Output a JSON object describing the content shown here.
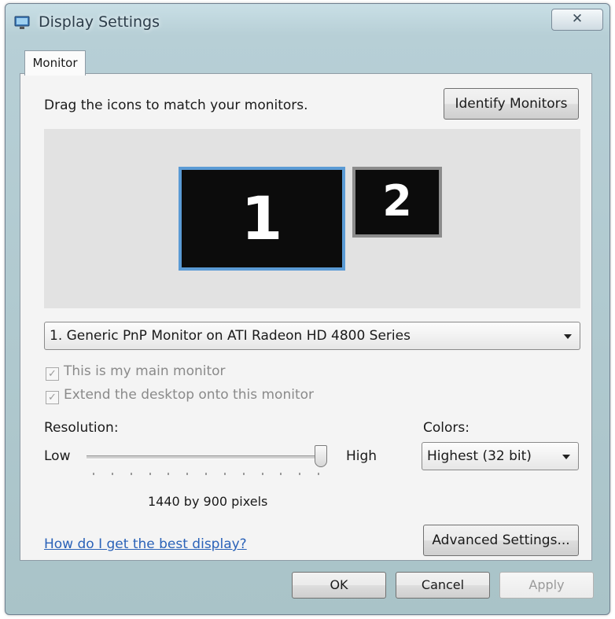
{
  "window": {
    "title": "Display Settings",
    "close_glyph": "✕",
    "icon": "display-settings-icon"
  },
  "tabs": [
    {
      "label": "Monitor",
      "selected": true
    }
  ],
  "monitor_tab": {
    "instruction": "Drag the icons to match your monitors.",
    "identify_button": "Identify Monitors",
    "monitors": [
      {
        "number": "1",
        "selected": true
      },
      {
        "number": "2",
        "selected": false
      }
    ],
    "monitor_select": {
      "value": "1. Generic PnP Monitor on ATI Radeon HD 4800 Series"
    },
    "main_monitor_checkbox": {
      "label": "This is my main monitor",
      "checked": true,
      "enabled": false
    },
    "extend_desktop_checkbox": {
      "label": "Extend the desktop onto this monitor",
      "checked": true,
      "enabled": false
    },
    "resolution": {
      "label": "Resolution:",
      "low_label": "Low",
      "high_label": "High",
      "slider_level": 1.0,
      "value_text": "1440 by 900 pixels"
    },
    "colors": {
      "label": "Colors:",
      "value": "Highest (32 bit)"
    },
    "help_link": "How do I get the best display?",
    "advanced_button": "Advanced Settings..."
  },
  "footer": {
    "ok_label": "OK",
    "cancel_label": "Cancel",
    "apply_label": "Apply"
  },
  "colors_palette": {
    "selected_monitor_border": "#5b9bd5",
    "link": "#2a62b8",
    "disabled_text": "#8a8a8a"
  }
}
